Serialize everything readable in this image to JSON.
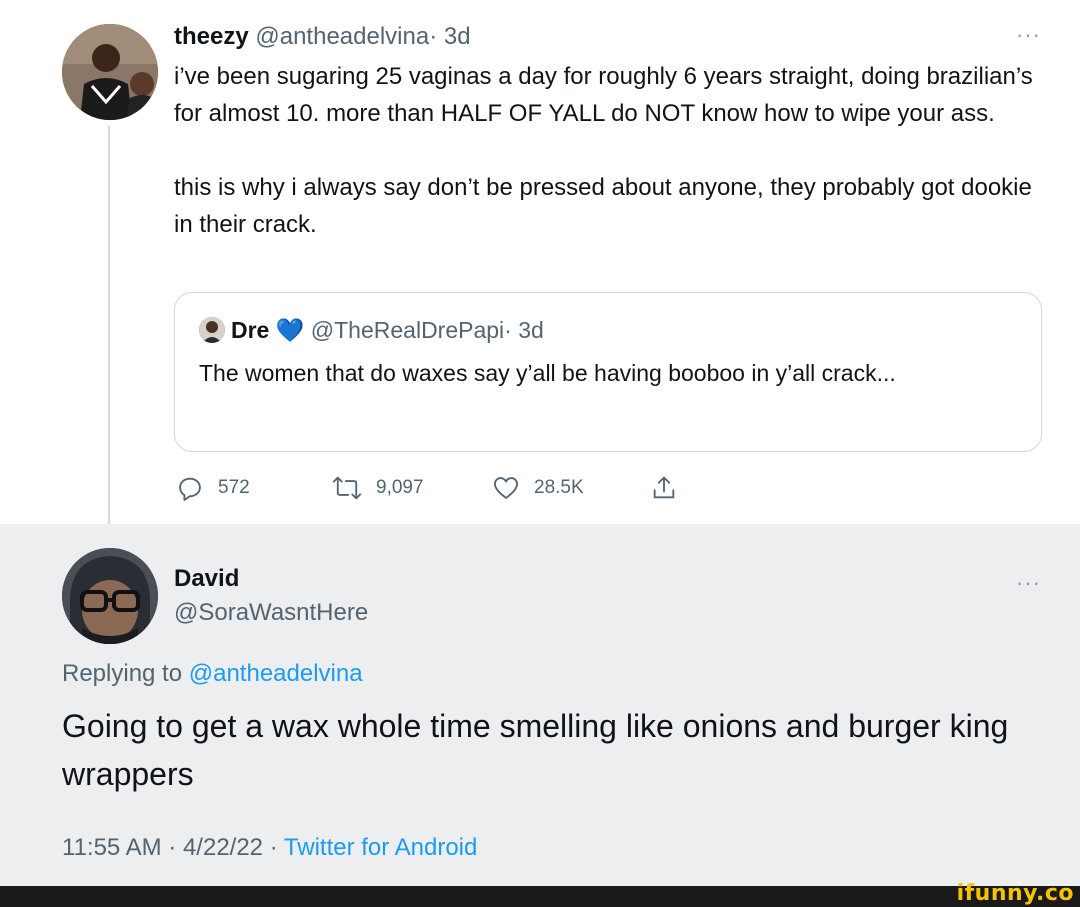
{
  "tweet": {
    "display_name": "theezy",
    "handle": "@antheadelvina",
    "time": "· 3d",
    "more": "···",
    "paragraphs": [
      "i’ve been sugaring 25 vaginas a day for roughly 6 years straight, doing brazilian’s for almost 10. more than HALF OF YALL do NOT know how to wipe your ass.",
      "this is why i always say don’t be pressed about anyone, they probably got dookie in their crack."
    ],
    "quote": {
      "display_name": "Dre",
      "emoji": "💙",
      "handle": "@TheRealDrePapi",
      "time": "· 3d",
      "text": "The women that do waxes say y’all be having booboo in y’all crack..."
    },
    "actions": {
      "replies": "572",
      "retweets": "9,097",
      "likes": "28.5K"
    }
  },
  "reply": {
    "display_name": "David",
    "handle": "@SoraWasntHere",
    "more": "···",
    "replying_prefix": "Replying to",
    "replying_handle": "@antheadelvina",
    "text": "Going to get a wax whole time smelling like onions and burger king wrappers",
    "timestamp": "11:55 AM · 4/22/22 ·",
    "client": "Twitter for Android"
  },
  "watermark": "ifunny.co",
  "colors": {
    "link": "#1d9bf0",
    "muted": "#536471",
    "reply_bg": "#eceef0",
    "watermark": "#f5c400",
    "heart": "#1d9bf0"
  }
}
